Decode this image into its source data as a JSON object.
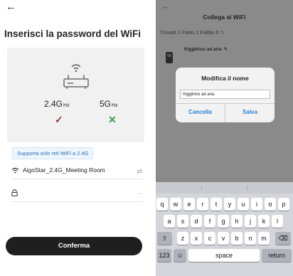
{
  "left": {
    "back_glyph": "←",
    "title": "Inserisci la password del WiFi",
    "band_24": "2.4G",
    "band_24_unit": "Hz",
    "band_5": "5G",
    "band_5_unit": "Hz",
    "band_24_mark": "✓",
    "band_5_mark": "✕",
    "hint": "Supporta solo reti WiFi a 2.4G",
    "network_name": "AigoStar_2.4G_Meeting Room",
    "password_value": "",
    "confirm_label": "Conferma",
    "icons": [
      "back-arrow-icon",
      "router-icon",
      "wifi-icon",
      "swap-icon",
      "lock-icon",
      "eye-hidden-icon"
    ]
  },
  "right": {
    "back_glyph": "←",
    "title": "Collega al WiFi",
    "stats": "Trovati 1  Fatto 1  Fallito 0",
    "refresh_glyph": "↻",
    "device_name": "friggitrice ad aria",
    "pencil_glyph": "✎",
    "dialog": {
      "title": "Modifica il nome",
      "input_value": "friggitrice ad aria",
      "cancel_label": "Cancella",
      "save_label": "Salva"
    },
    "keyboard": {
      "row1": [
        "q",
        "w",
        "e",
        "r",
        "t",
        "y",
        "u",
        "i",
        "o",
        "p"
      ],
      "row2": [
        "a",
        "s",
        "d",
        "f",
        "g",
        "h",
        "j",
        "k",
        "l"
      ],
      "row3": [
        "z",
        "x",
        "c",
        "v",
        "b",
        "n",
        "m"
      ],
      "shift_glyph": "⇧",
      "delete_glyph": "⌫",
      "numbers_label": "123",
      "emoji_glyph": "☺",
      "space_label": "space",
      "return_label": "return"
    }
  },
  "colors": {
    "accent_blue": "#2a7fd2",
    "check_red": "#a0342f",
    "cross_green": "#3c9a4c",
    "button_dark": "#1f1f1f"
  }
}
